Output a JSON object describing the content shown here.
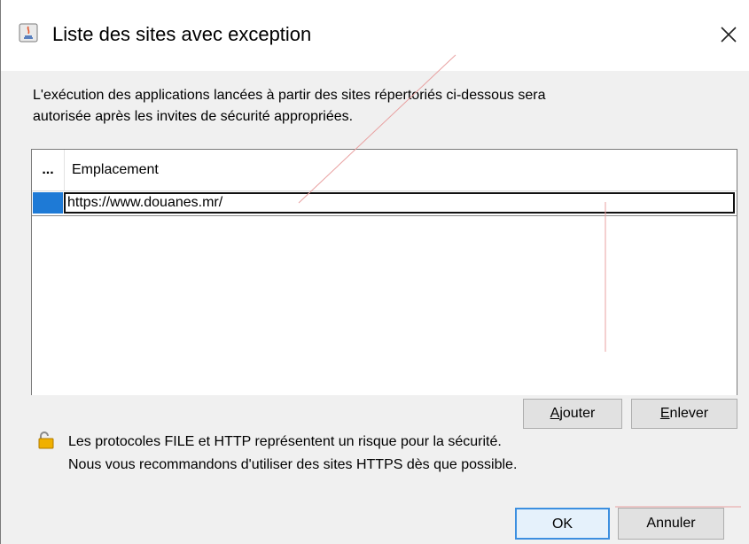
{
  "window": {
    "title": "Liste des sites avec exception",
    "icons": {
      "app": "java-icon",
      "close": "close-icon"
    }
  },
  "description": {
    "line1": "L'exécution des applications lancées à partir des sites répertoriés ci-dessous sera",
    "line2": "autorisée après les invites de sécurité appropriées."
  },
  "table": {
    "headers": [
      "...",
      "Emplacement"
    ],
    "rows": [
      {
        "location": "https://www.douanes.mr/"
      }
    ]
  },
  "buttons": {
    "add": {
      "mnemonic": "A",
      "rest": "jouter"
    },
    "remove": {
      "mnemonic": "E",
      "rest": "nlever"
    },
    "ok": "OK",
    "cancel": "Annuler"
  },
  "warning": {
    "icon": "lock-icon",
    "line1": "Les protocoles FILE et HTTP représentent un risque pour la sécurité.",
    "line2": "Nous vous recommandons d'utiliser des sites HTTPS dès que possible."
  },
  "colors": {
    "selection": "#1e7ad6",
    "dialog_bg": "#f0f0f0",
    "annotation": "#e8a0a0"
  }
}
